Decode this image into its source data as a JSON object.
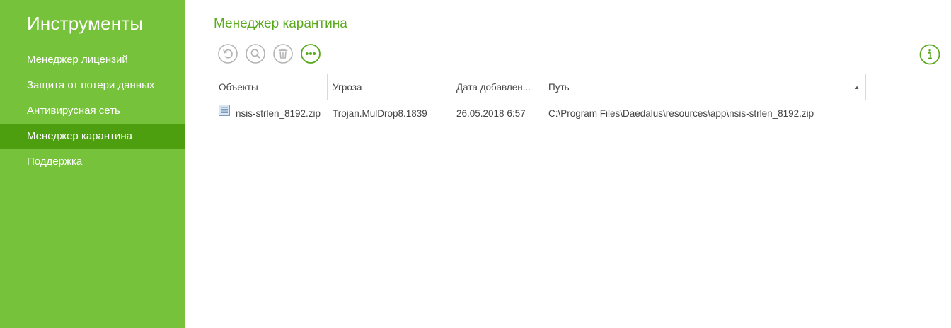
{
  "sidebar": {
    "title": "Инструменты",
    "items": [
      {
        "label": "Менеджер лицензий",
        "active": false
      },
      {
        "label": "Защита от потери данных",
        "active": false
      },
      {
        "label": "Антивирусная сеть",
        "active": false
      },
      {
        "label": "Менеджер карантина",
        "active": true
      },
      {
        "label": "Поддержка",
        "active": false
      }
    ]
  },
  "main": {
    "title": "Менеджер карантина",
    "toolbar": {
      "buttons": [
        {
          "icon": "restore-icon"
        },
        {
          "icon": "search-icon"
        },
        {
          "icon": "trash-icon"
        },
        {
          "icon": "more-icon"
        }
      ],
      "info_icon": "info-icon"
    },
    "table": {
      "columns": [
        "Объекты",
        "Угроза",
        "Дата добавлен...",
        "Путь"
      ],
      "sort_indicator": "▲",
      "rows": [
        {
          "icon": "file-icon",
          "object": "nsis-strlen_8192.zip",
          "threat": "Trojan.MulDrop8.1839",
          "date": "26.05.2018 6:57",
          "path": "C:\\Program Files\\Daedalus\\resources\\app\\nsis-strlen_8192.zip"
        }
      ]
    }
  },
  "colors": {
    "sidebar_bg": "#77c23b",
    "sidebar_active": "#4e9f10",
    "accent": "#5aaa1e",
    "icon_gray": "#b3b3b3"
  }
}
